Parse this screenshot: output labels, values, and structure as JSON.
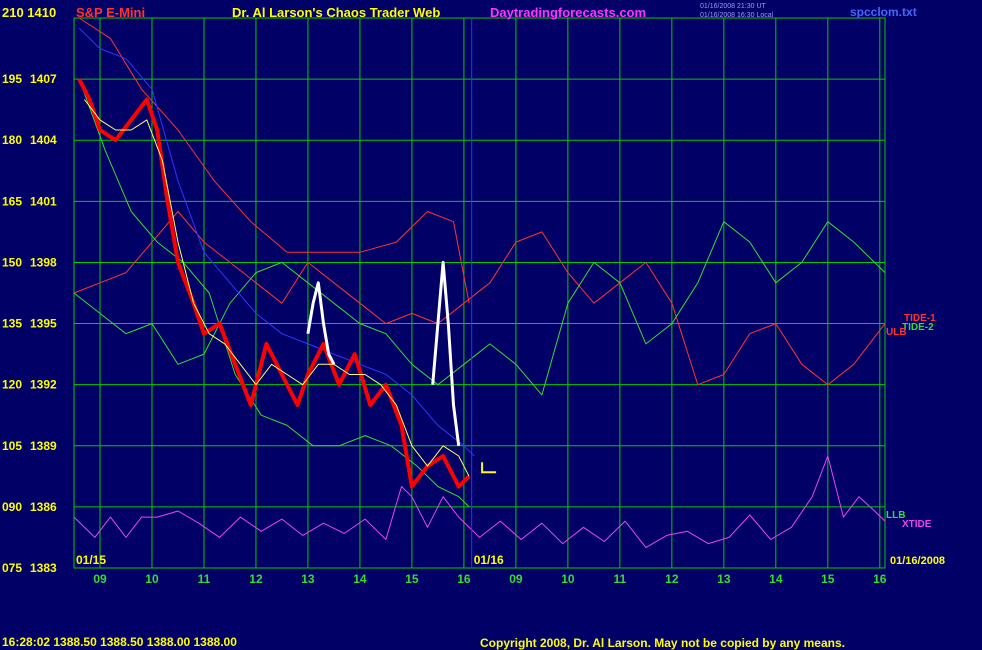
{
  "header": {
    "axis_top": "210 1410",
    "symbol": "S&P E-Mini",
    "title": "Dr. Al Larson's Chaos Trader Web",
    "site": "Daytradingforecasts.com",
    "stamp_1": "01/16/2008 21:30 UT",
    "stamp_2": "01/16/2008 16:30 Local",
    "file": "spcclom.txt"
  },
  "footer": {
    "quote": "16:28:02  1388.50 1388.50 1388.00 1388.00",
    "copyright": "Copyright 2008, Dr. Al Larson. May not be copied by any means."
  },
  "colors": {
    "background": "#000066",
    "grid": "#00cc00",
    "price": "#ff0000",
    "price_future": "#ffffff",
    "short_ma": "#ffff66",
    "xtide": "#ee44ee",
    "tide1": "#ff3333",
    "tide2": "#33dd33",
    "long_ma": "#3333ff",
    "labels": "#ffff00",
    "hour_labels": "#33dd33",
    "site": "#ff33ff"
  },
  "chart_data": {
    "type": "line",
    "y_left_labels": [
      "210",
      "195",
      "180",
      "165",
      "150",
      "135",
      "120",
      "105",
      "090",
      "075"
    ],
    "y_price_labels": [
      "1410",
      "1407",
      "1404",
      "1401",
      "1398",
      "1395",
      "1392",
      "1389",
      "1386",
      "1383"
    ],
    "y_left_range": [
      75,
      210
    ],
    "y_price_range": [
      1383,
      1410
    ],
    "date_labels": [
      "01/15",
      "01/16",
      "01/16/2008"
    ],
    "hour_labels": [
      "09",
      "10",
      "11",
      "12",
      "13",
      "14",
      "15",
      "16",
      "09",
      "10",
      "11",
      "12",
      "13",
      "14",
      "15",
      "16"
    ],
    "grid": true,
    "series_labels": [
      "TIDE-1",
      "TIDE-2",
      "ULB",
      "LLB",
      "XTIDE"
    ],
    "series": [
      {
        "name": "price",
        "x": [
          8.6,
          8.8,
          9.0,
          9.3,
          9.6,
          9.9,
          10.1,
          10.3,
          10.5,
          10.8,
          11.0,
          11.3,
          11.6,
          11.9,
          12.2,
          12.5,
          12.8,
          13.0,
          13.3,
          13.6,
          13.9,
          14.2,
          14.5,
          14.8,
          15.0,
          15.3,
          15.6,
          15.9,
          16.1
        ],
        "y": [
          1407,
          1406,
          1404.5,
          1404,
          1405,
          1406,
          1404.5,
          1401,
          1398,
          1396,
          1394.5,
          1395,
          1393,
          1391,
          1394,
          1392.5,
          1391,
          1392.5,
          1394,
          1392,
          1393.5,
          1391,
          1392,
          1390,
          1387,
          1388,
          1388.5,
          1387,
          1387.5
        ]
      },
      {
        "name": "price_future",
        "x": [
          13.0,
          13.1,
          13.2,
          13.3,
          13.4,
          13.5,
          15.4,
          15.5,
          15.6,
          15.7,
          15.8,
          15.9
        ],
        "y": [
          1394.5,
          1396,
          1397,
          1395,
          1393.5,
          1393,
          1392,
          1395,
          1398,
          1395,
          1391,
          1389
        ]
      },
      {
        "name": "short_ma",
        "x": [
          8.7,
          9.0,
          9.3,
          9.6,
          9.9,
          10.2,
          10.5,
          10.8,
          11.1,
          11.4,
          11.7,
          12.0,
          12.3,
          12.6,
          12.9,
          13.2,
          13.5,
          13.8,
          14.1,
          14.4,
          14.7,
          15.0,
          15.3,
          15.6,
          15.9,
          16.1
        ],
        "y": [
          1406,
          1405,
          1404.5,
          1404.5,
          1405,
          1403,
          1399,
          1396,
          1394.5,
          1394,
          1393,
          1392,
          1393,
          1392.5,
          1392,
          1393,
          1393,
          1392.5,
          1392.5,
          1392,
          1391,
          1389,
          1388,
          1389,
          1388.5,
          1387.5
        ]
      },
      {
        "name": "long_ma",
        "x": [
          8.6,
          9.0,
          9.5,
          10.0,
          10.5,
          11.0,
          11.5,
          12.0,
          12.5,
          13.0,
          13.5,
          14.0,
          14.5,
          15.0,
          15.5,
          16.0,
          16.2
        ],
        "y": [
          1409.5,
          1408.5,
          1408,
          1406.5,
          1402,
          1398.5,
          1397,
          1395.5,
          1394.5,
          1394,
          1393.5,
          1393,
          1392.5,
          1391.5,
          1390,
          1389,
          1388.5
        ]
      },
      {
        "name": "TIDE-1",
        "x": [
          8.5,
          9.0,
          9.5,
          10.0,
          10.5,
          11.0,
          11.5,
          12.0,
          12.5,
          13.0,
          13.5,
          14.0,
          14.5,
          15.0,
          15.5,
          16.0,
          16.5,
          17.0,
          17.5,
          18.0,
          18.5,
          19.0,
          19.5,
          20.0,
          20.5,
          21.0,
          21.5,
          22.0,
          22.5,
          23.0,
          23.5,
          24.1
        ],
        "y": [
          1396.5,
          1397,
          1397.5,
          1399,
          1400.5,
          1399,
          1398,
          1397,
          1396,
          1398,
          1397,
          1396,
          1395,
          1395.5,
          1395,
          1396,
          1397,
          1399,
          1399.5,
          1397.5,
          1396,
          1397,
          1398,
          1396,
          1392,
          1392.5,
          1394.5,
          1395,
          1393,
          1392,
          1393,
          1395
        ]
      },
      {
        "name": "ULB",
        "x": [
          8.6,
          9.2,
          9.8,
          10.5,
          11.2,
          11.9,
          12.6,
          13.3,
          14.0,
          14.7,
          15.3,
          15.8,
          16.1
        ],
        "y": [
          1410,
          1409,
          1406.5,
          1404.5,
          1402,
          1400,
          1398.5,
          1398.5,
          1398.5,
          1399,
          1400.5,
          1400,
          1396
        ]
      },
      {
        "name": "TIDE-2",
        "x": [
          8.5,
          9.0,
          9.5,
          10.0,
          10.5,
          11.0,
          11.5,
          12.0,
          12.5,
          13.0,
          13.5,
          14.0,
          14.5,
          15.0,
          15.5,
          16.0,
          16.5,
          17.0,
          17.5,
          18.0,
          18.5,
          19.0,
          19.5,
          20.0,
          20.5,
          21.0,
          21.5,
          22.0,
          22.5,
          23.0,
          23.5,
          24.1
        ],
        "y": [
          1396.5,
          1395.5,
          1394.5,
          1395,
          1393,
          1393.5,
          1396,
          1397.5,
          1398,
          1397,
          1396,
          1395,
          1394.5,
          1393,
          1392,
          1393,
          1394,
          1393,
          1391.5,
          1396,
          1398,
          1397,
          1394,
          1395,
          1397,
          1400,
          1399,
          1397,
          1398,
          1400,
          1399,
          1397.5
        ]
      },
      {
        "name": "LLB",
        "x": [
          8.6,
          9.1,
          9.6,
          10.1,
          10.6,
          11.1,
          11.6,
          12.1,
          12.6,
          13.1,
          13.6,
          14.1,
          14.6,
          15.1,
          15.5,
          15.9,
          16.1
        ],
        "y": [
          1407,
          1403.5,
          1400.5,
          1399,
          1398,
          1396.5,
          1392.5,
          1390.5,
          1390,
          1389,
          1389,
          1389.5,
          1389,
          1388,
          1387,
          1386.5,
          1386
        ]
      },
      {
        "name": "XTIDE",
        "x": [
          8.5,
          8.9,
          9.2,
          9.5,
          9.8,
          10.1,
          10.5,
          10.9,
          11.3,
          11.7,
          12.1,
          12.5,
          12.9,
          13.3,
          13.7,
          14.1,
          14.5,
          14.8,
          15.0,
          15.3,
          15.6,
          15.9,
          16.3,
          16.7,
          17.1,
          17.5,
          17.9,
          18.3,
          18.7,
          19.1,
          19.5,
          19.9,
          20.3,
          20.7,
          21.1,
          21.5,
          21.9,
          22.3,
          22.7,
          23.0,
          23.3,
          23.6,
          23.9,
          24.1
        ],
        "y": [
          1385.5,
          1384.5,
          1385.5,
          1384.5,
          1385.5,
          1385.5,
          1385.8,
          1385.2,
          1384.5,
          1385.5,
          1384.8,
          1385.4,
          1384.6,
          1385.2,
          1384.7,
          1385.4,
          1384.4,
          1387,
          1386.5,
          1385,
          1386.5,
          1385.5,
          1384.5,
          1385.3,
          1384.4,
          1385.2,
          1384.2,
          1385,
          1384.3,
          1385.3,
          1384,
          1384.6,
          1384.8,
          1384.2,
          1384.5,
          1385.6,
          1384.4,
          1385,
          1386.5,
          1388.5,
          1385.5,
          1386.5,
          1385.8,
          1385.3
        ]
      }
    ]
  }
}
